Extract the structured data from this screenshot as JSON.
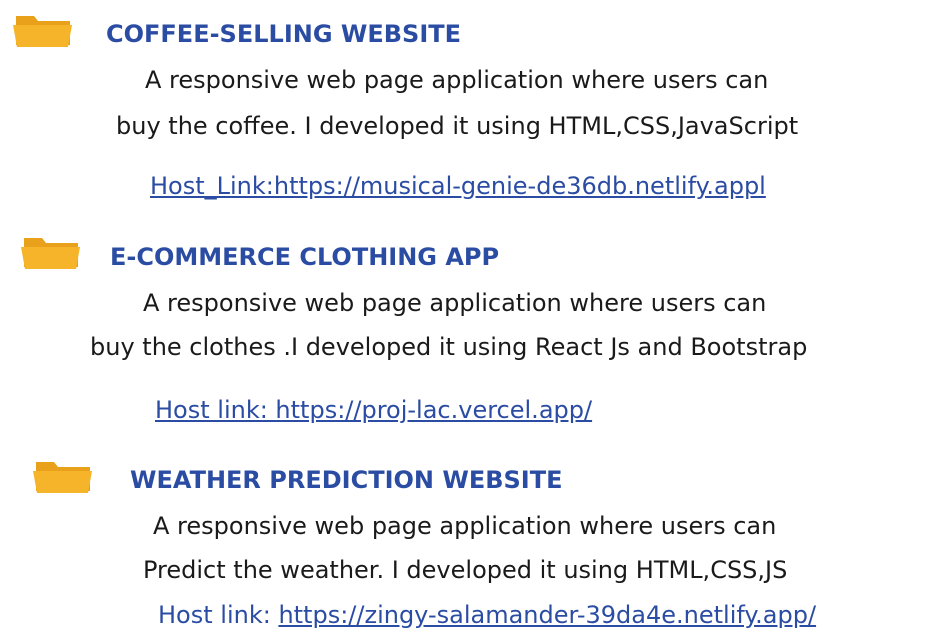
{
  "colors": {
    "heading": "#2b4ca3",
    "link": "#2b4ca3",
    "text": "#1a1a1a",
    "folder": "#f2a91f"
  },
  "projects": [
    {
      "icon": "folder-icon",
      "title": "COFFEE-SELLING WEBSITE",
      "desc_line1": "A responsive web page application where users can",
      "desc_line2": "buy the coffee. I developed it using HTML,CSS,JavaScript",
      "link_text": "Host_Link:https://musical-genie-de36db.netlify.appl"
    },
    {
      "icon": "folder-icon",
      "title": "E-COMMERCE CLOTHING APP",
      "desc_line1": "A responsive web page application where users can",
      "desc_line2": "buy the clothes .I developed it using React Js and Bootstrap",
      "link_text": "Host link: https://proj-lac.vercel.app/"
    },
    {
      "icon": "folder-icon",
      "title": "WEATHER PREDICTION WEBSITE",
      "desc_line1": "A responsive web page application where users can",
      "desc_line2": "Predict the weather. I developed it using HTML,CSS,JS",
      "link_prefix": "Host link: ",
      "link_text": "https://zingy-salamander-39da4e.netlify.app/"
    }
  ]
}
